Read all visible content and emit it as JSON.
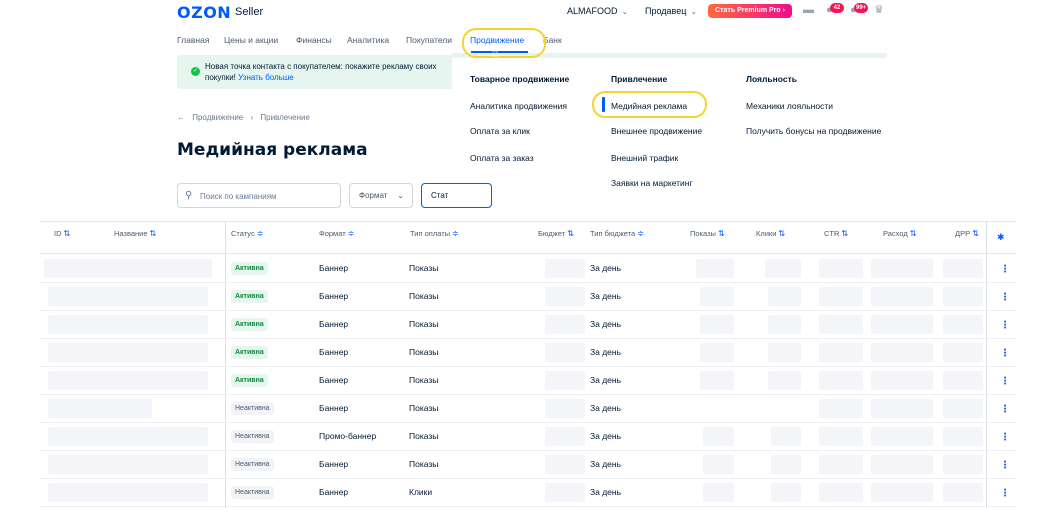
{
  "topbar": {
    "logo": "OZON",
    "logo_sub": "Seller",
    "store": "ALMAFOOD",
    "role": "Продавец",
    "premium_button": "Стать Premium Pro",
    "badges": {
      "notifications": "42",
      "messages": "99+"
    },
    "icons": [
      "chat-icon",
      "bell-icon",
      "notifications-icon",
      "crown-icon"
    ]
  },
  "nav": {
    "items": [
      "Главная",
      "Цены и акции",
      "Финансы",
      "Аналитика",
      "Покупатели",
      "Продвижение",
      "Банк"
    ],
    "active": "Продвижение"
  },
  "banner": {
    "text": "Новая точка контакта с покупателем: покажите рекламу своих покупки!",
    "link": "Узнать больше"
  },
  "dropdown": {
    "columns": [
      {
        "title": "Товарное продвижение",
        "items": [
          "Аналитика продвижения",
          "Оплата за клик",
          "Оплата за заказ"
        ]
      },
      {
        "title": "Привлечение",
        "items": [
          "Медийная реклама",
          "Внешнее продвижение",
          "Внешний трафик",
          "Заявки на маркетинг"
        ]
      },
      {
        "title": "Лояльность",
        "items": [
          "Механики лояльности",
          "Получить бонусы на продвижение"
        ]
      }
    ],
    "active_item": "Медийная реклама"
  },
  "breadcrumb": {
    "back": "←",
    "items": [
      "Продвижение",
      "›",
      "Привлечение"
    ]
  },
  "page_title": "Медийная реклама",
  "filters": {
    "search_placeholder": "Поиск по кампаниям",
    "format_label": "Формат",
    "status_label": "Стат"
  },
  "table": {
    "headers": [
      "ID",
      "Название",
      "Статус",
      "Формат",
      "Тип оплаты",
      "Бюджет",
      "Тип бюджета",
      "Показы",
      "Клики",
      "CTR",
      "Расход",
      "ДРР"
    ],
    "rows": [
      {
        "status": "Активна",
        "status_type": "active",
        "format": "Баннер",
        "payment": "Показы",
        "budget_type": "За день"
      },
      {
        "status": "Активна",
        "status_type": "active",
        "format": "Баннер",
        "payment": "Показы",
        "budget_type": "За день"
      },
      {
        "status": "Активна",
        "status_type": "active",
        "format": "Баннер",
        "payment": "Показы",
        "budget_type": "За день"
      },
      {
        "status": "Активна",
        "status_type": "active",
        "format": "Баннер",
        "payment": "Показы",
        "budget_type": "За день"
      },
      {
        "status": "Активна",
        "status_type": "active",
        "format": "Баннер",
        "payment": "Показы",
        "budget_type": "За день"
      },
      {
        "status": "Неактивна",
        "status_type": "inactive",
        "format": "Баннер",
        "payment": "Показы",
        "budget_type": "За день"
      },
      {
        "status": "Неактивна",
        "status_type": "inactive",
        "format": "Промо-баннер",
        "payment": "Показы",
        "budget_type": "За день"
      },
      {
        "status": "Неактивна",
        "status_type": "inactive",
        "format": "Баннер",
        "payment": "Показы",
        "budget_type": "За день"
      },
      {
        "status": "Неактивна",
        "status_type": "inactive",
        "format": "Баннер",
        "payment": "Клики",
        "budget_type": "За день"
      }
    ]
  },
  "colors": {
    "brand": "#005bff",
    "active_green": "#0a8a3a",
    "highlight": "#f5d432",
    "premium_from": "#ff6a3d",
    "premium_to": "#f10c8c"
  }
}
